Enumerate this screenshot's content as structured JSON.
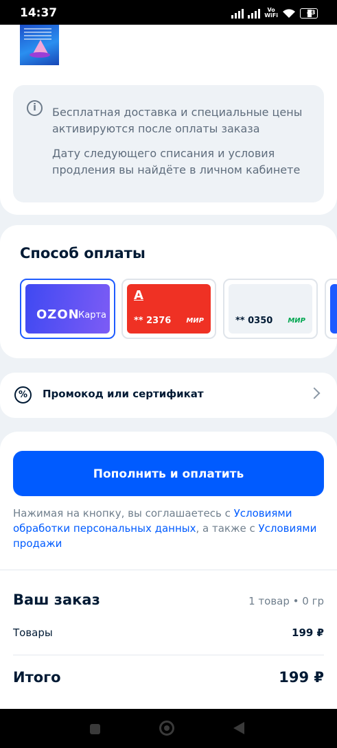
{
  "status_bar": {
    "time": "14:37",
    "network_label_line1": "Vo",
    "network_label_line2": "WiFi",
    "battery": "43"
  },
  "info": {
    "line1": "Бесплатная доставка и специальные цены активируются после оплаты заказа",
    "line2": "Дату следующего списания и условия продления вы найдёте в личном кабинете",
    "icon": "info-icon"
  },
  "payment": {
    "title": "Способ оплаты",
    "methods": [
      {
        "logo": "OZON",
        "label": "Карта",
        "selected": true
      },
      {
        "bank_letter": "А",
        "number": "** 2376",
        "system": "МИР",
        "color": "#ef3124"
      },
      {
        "number": "** 0350",
        "system": "МИР",
        "system_color": "#00a650"
      }
    ]
  },
  "promo": {
    "label": "Промокод или сертификат",
    "icon": "discount-icon"
  },
  "button": {
    "label": "Пополнить и оплатить",
    "color": "#005bff"
  },
  "terms": {
    "text1": "Нажимая на кнопку, вы соглашаетесь с ",
    "link1": "Условиями обработки персональных данных",
    "text2": ", а также с ",
    "link2": "Условиями продажи"
  },
  "order": {
    "title": "Ваш заказ",
    "meta": "1 товар • 0 гр",
    "items_label": "Товары",
    "items_value": "199 ₽",
    "total_label": "Итого",
    "total_value": "199 ₽"
  }
}
